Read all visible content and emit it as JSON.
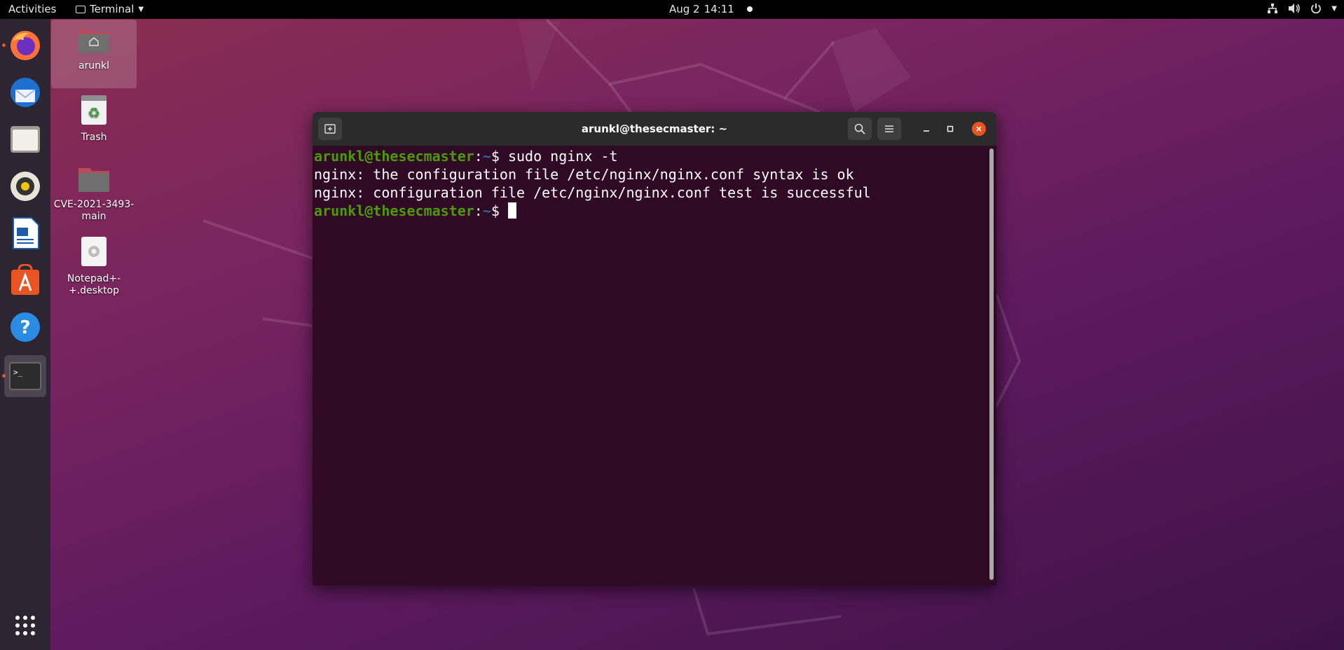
{
  "topbar": {
    "activities": "Activities",
    "app_name": "Terminal",
    "date": "Aug 2",
    "time": "14:11"
  },
  "dock": {
    "items": [
      {
        "name": "Firefox",
        "icon": "firefox-icon",
        "running": true
      },
      {
        "name": "Thunderbird",
        "icon": "thunderbird-icon",
        "running": false
      },
      {
        "name": "Files",
        "icon": "files-icon",
        "running": false
      },
      {
        "name": "Rhythmbox",
        "icon": "rhythmbox-icon",
        "running": false
      },
      {
        "name": "LibreOffice Writer",
        "icon": "writer-icon",
        "running": false
      },
      {
        "name": "Ubuntu Software",
        "icon": "software-icon",
        "running": false
      },
      {
        "name": "Help",
        "icon": "help-icon",
        "running": false
      },
      {
        "name": "Terminal",
        "icon": "terminal-icon",
        "running": true,
        "active": true
      }
    ],
    "apps_grid_icon": "grid-icon"
  },
  "desktop": {
    "icons": [
      {
        "label": "arunkl",
        "icon": "home-folder-icon"
      },
      {
        "label": "Trash",
        "icon": "trash-icon"
      },
      {
        "label": "CVE-2021-3493-main",
        "label_lines": [
          "CVE-2021-3493-",
          "main"
        ],
        "icon": "folder-icon"
      },
      {
        "label": "Notepad++.desktop",
        "label_lines": [
          "Notepad+-",
          "+.desktop"
        ],
        "icon": "desktop-file-icon"
      }
    ]
  },
  "terminal": {
    "title": "arunkl@thesecmaster: ~",
    "lines": [
      {
        "type": "prompt",
        "user": "arunkl@thesecmaster",
        "sep": ":",
        "path": "~",
        "symbol": "$",
        "command": " sudo nginx -t"
      },
      {
        "type": "output",
        "text": "nginx: the configuration file /etc/nginx/nginx.conf syntax is ok"
      },
      {
        "type": "output",
        "text": "nginx: configuration file /etc/nginx/nginx.conf test is successful"
      },
      {
        "type": "prompt",
        "user": "arunkl@thesecmaster",
        "sep": ":",
        "path": "~",
        "symbol": "$",
        "command": " "
      }
    ]
  },
  "colors": {
    "accent": "#e95420",
    "terminal_bg": "#300a24",
    "prompt_user": "#4e9a06",
    "prompt_path": "#3465a4"
  }
}
